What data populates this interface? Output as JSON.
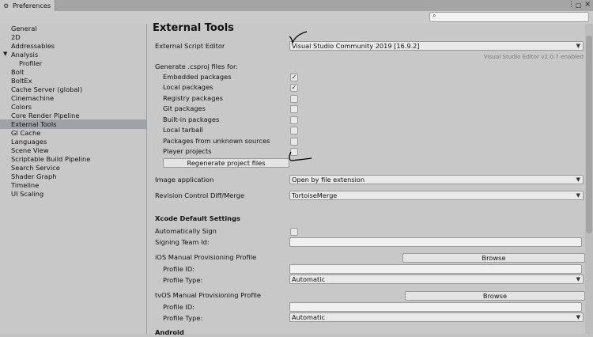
{
  "window": {
    "tab_title": "Preferences",
    "menu_glyph": "⋮",
    "maximize_glyph": "□",
    "close_glyph": "×"
  },
  "search": {
    "placeholder": ""
  },
  "sidebar": {
    "items": [
      {
        "label": "General"
      },
      {
        "label": "2D"
      },
      {
        "label": "Addressables"
      },
      {
        "label": "Analysis"
      },
      {
        "label": "Profiler"
      },
      {
        "label": "Bolt"
      },
      {
        "label": "BoltEx"
      },
      {
        "label": "Cache Server (global)"
      },
      {
        "label": "Cinemachine"
      },
      {
        "label": "Colors"
      },
      {
        "label": "Core Render Pipeline"
      },
      {
        "label": "External Tools"
      },
      {
        "label": "GI Cache"
      },
      {
        "label": "Languages"
      },
      {
        "label": "Scene View"
      },
      {
        "label": "Scriptable Build Pipeline"
      },
      {
        "label": "Search Service"
      },
      {
        "label": "Shader Graph"
      },
      {
        "label": "Timeline"
      },
      {
        "label": "UI Scaling"
      }
    ],
    "selected": "External Tools"
  },
  "main": {
    "title": "External Tools",
    "external_script_editor": {
      "label": "External Script Editor",
      "value": "Visual Studio Community 2019 [16.9.2]",
      "version_note": "Visual Studio Editor v2.0.7 enabled"
    },
    "generate_label": "Generate .csproj files for:",
    "csproj_options": [
      {
        "label": "Embedded packages",
        "checked": true
      },
      {
        "label": "Local packages",
        "checked": true
      },
      {
        "label": "Registry packages",
        "checked": false
      },
      {
        "label": "Git packages",
        "checked": false
      },
      {
        "label": "Built-in packages",
        "checked": false
      },
      {
        "label": "Local tarball",
        "checked": false
      },
      {
        "label": "Packages from unknown sources",
        "checked": false
      },
      {
        "label": "Player projects",
        "checked": false
      }
    ],
    "check_glyph": "✓",
    "regenerate_button": "Regenerate project files",
    "image_application": {
      "label": "Image application",
      "value": "Open by file extension"
    },
    "revision_control": {
      "label": "Revision Control Diff/Merge",
      "value": "TortoiseMerge"
    },
    "xcode": {
      "heading": "Xcode Default Settings",
      "auto_sign_label": "Automatically Sign",
      "auto_sign_checked": false,
      "signing_team_label": "Signing Team Id:",
      "signing_team_value": "",
      "ios": {
        "label": "iOS Manual Provisioning Profile",
        "browse": "Browse",
        "profile_id_label": "Profile ID:",
        "profile_id_value": "",
        "profile_type_label": "Profile Type:",
        "profile_type_value": "Automatic"
      },
      "tvos": {
        "label": "tvOS Manual Provisioning Profile",
        "browse": "Browse",
        "profile_id_label": "Profile ID:",
        "profile_id_value": "",
        "profile_type_label": "Profile Type:",
        "profile_type_value": "Automatic"
      }
    },
    "android_heading": "Android"
  }
}
